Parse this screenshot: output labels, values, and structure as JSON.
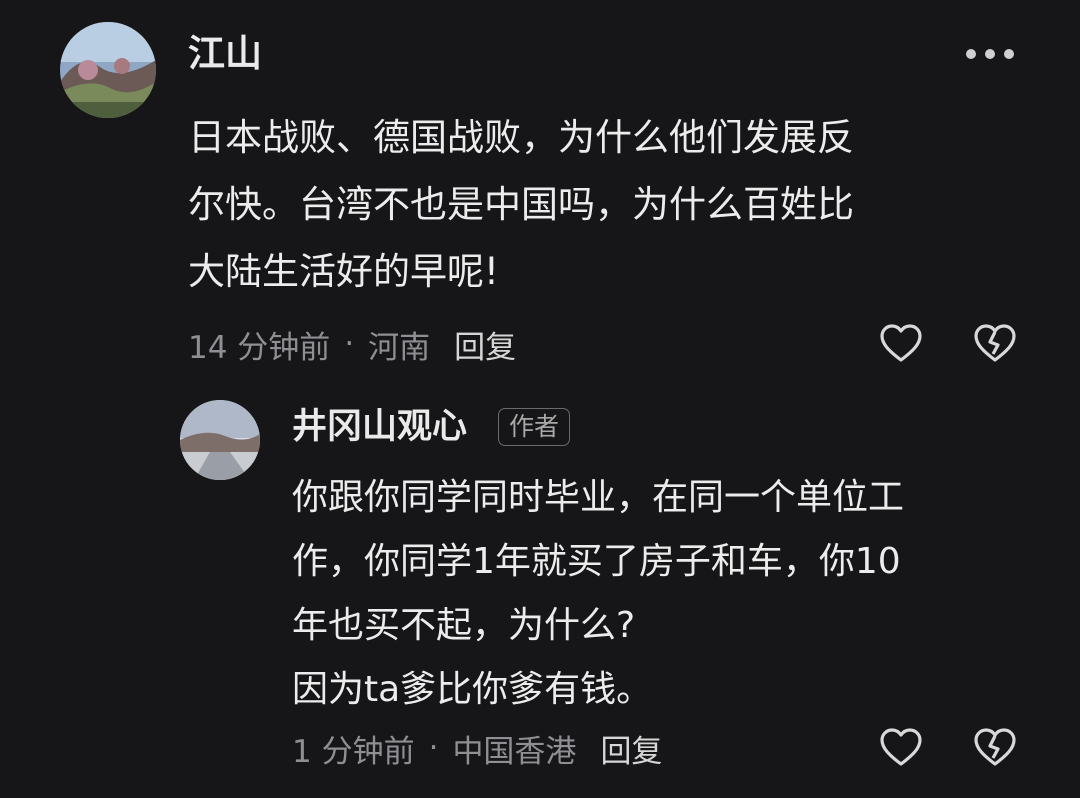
{
  "comment": {
    "author": "江山",
    "text": "日本战败、德国战败，为什么他们发展反\n尔快。台湾不也是中国吗，为什么百姓比\n大陆生活好的早呢!",
    "time": "14 分钟前",
    "separator": "·",
    "location": "河南",
    "reply_label": "回复",
    "more_icon": "more-dots-icon",
    "like_icon": "heart-icon",
    "dislike_icon": "broken-heart-icon"
  },
  "reply": {
    "author": "井冈山观心",
    "author_badge": "作者",
    "text": "你跟你同学同时毕业，在同一个单位工\n作，你同学1年就买了房子和车，你10\n年也买不起，为什么?\n因为ta爹比你爹有钱。",
    "time": "1 分钟前",
    "separator": "·",
    "location": "中国香港",
    "reply_label": "回复",
    "like_icon": "heart-icon",
    "dislike_icon": "broken-heart-icon"
  }
}
